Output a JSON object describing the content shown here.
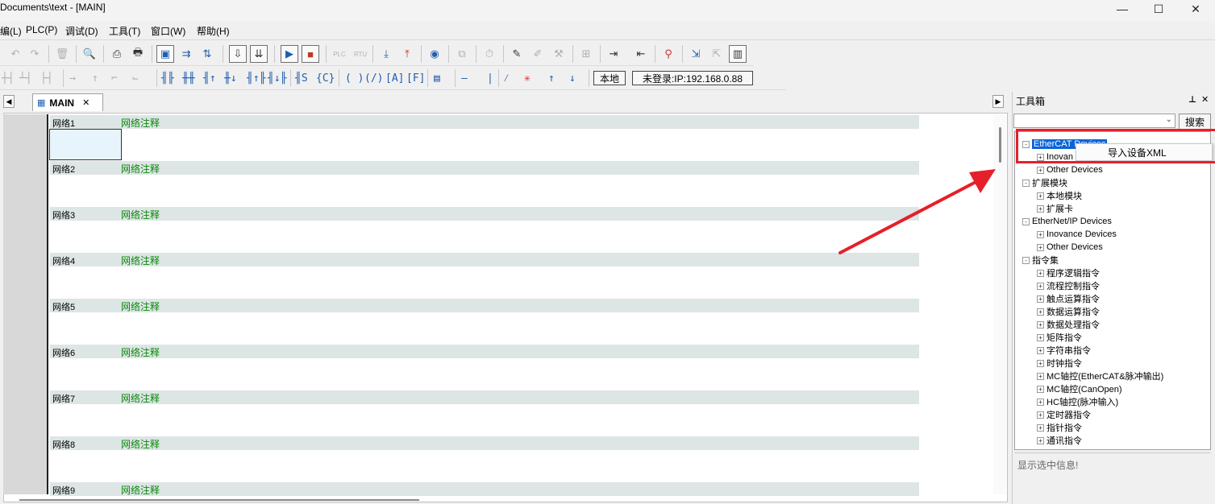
{
  "window": {
    "title": "Documents\\text - [MAIN]",
    "minimize": "—",
    "maximize": "☐",
    "close": "✕"
  },
  "menu": [
    "编(L)",
    "PLC(P)",
    "调试(D)",
    "工具(T)",
    "窗口(W)",
    "帮助(H)"
  ],
  "toolbar2": {
    "ladder_symbols": [
      "-| |-",
      "-|/|-",
      "-|↑|-",
      "-|↓|-",
      "( )",
      "(/)",
      "[A]",
      "[F]"
    ],
    "local_label": "本地",
    "login_status": "未登录:IP:192.168.0.88"
  },
  "tabs": {
    "active": "MAIN",
    "close": "✕"
  },
  "networks": [
    {
      "name": "网络1",
      "comment": "网络注释"
    },
    {
      "name": "网络2",
      "comment": "网络注释"
    },
    {
      "name": "网络3",
      "comment": "网络注释"
    },
    {
      "name": "网络4",
      "comment": "网络注释"
    },
    {
      "name": "网络5",
      "comment": "网络注释"
    },
    {
      "name": "网络6",
      "comment": "网络注释"
    },
    {
      "name": "网络7",
      "comment": "网络注释"
    },
    {
      "name": "网络8",
      "comment": "网络注释"
    },
    {
      "name": "网络9",
      "comment": "网络注释"
    }
  ],
  "toolbox": {
    "title": "工具箱",
    "pin": "⊼",
    "close": "✕",
    "search_button": "搜索",
    "tree": [
      {
        "label": "EtherCAT Devices",
        "level": 0,
        "selected": true,
        "expander": "-"
      },
      {
        "label": "Inovan",
        "level": 1,
        "expander": "+"
      },
      {
        "label": "Other Devices",
        "level": 1,
        "expander": "+"
      },
      {
        "label": "扩展模块",
        "level": 0,
        "expander": "-"
      },
      {
        "label": "本地模块",
        "level": 1,
        "expander": "+"
      },
      {
        "label": "扩展卡",
        "level": 1,
        "expander": "+"
      },
      {
        "label": "EtherNet/IP Devices",
        "level": 0,
        "expander": "-"
      },
      {
        "label": "Inovance Devices",
        "level": 1,
        "expander": "+"
      },
      {
        "label": "Other Devices",
        "level": 1,
        "expander": "+"
      },
      {
        "label": "指令集",
        "level": 0,
        "expander": "-"
      },
      {
        "label": "程序逻辑指令",
        "level": 1,
        "expander": "+"
      },
      {
        "label": "流程控制指令",
        "level": 1,
        "expander": "+"
      },
      {
        "label": "触点运算指令",
        "level": 1,
        "expander": "+"
      },
      {
        "label": "数据运算指令",
        "level": 1,
        "expander": "+"
      },
      {
        "label": "数据处理指令",
        "level": 1,
        "expander": "+"
      },
      {
        "label": "矩阵指令",
        "level": 1,
        "expander": "+"
      },
      {
        "label": "字符串指令",
        "level": 1,
        "expander": "+"
      },
      {
        "label": "时钟指令",
        "level": 1,
        "expander": "+"
      },
      {
        "label": "MC轴控(EtherCAT&脉冲输出)",
        "level": 1,
        "expander": "+"
      },
      {
        "label": "MC轴控(CanOpen)",
        "level": 1,
        "expander": "+"
      },
      {
        "label": "HC轴控(脉冲输入)",
        "level": 1,
        "expander": "+"
      },
      {
        "label": "定时器指令",
        "level": 1,
        "expander": "+"
      },
      {
        "label": "指针指令",
        "level": 1,
        "expander": "+"
      },
      {
        "label": "通讯指令",
        "level": 1,
        "expander": "+"
      }
    ],
    "info_text": "显示选中信息!"
  },
  "context_menu": {
    "item": "导入设备XML"
  },
  "colors": {
    "annotation_red": "#e5202a",
    "comment_green": "#0b8a0b",
    "selection_blue": "#0a64d8",
    "network_header_bg": "#dde5e5"
  }
}
